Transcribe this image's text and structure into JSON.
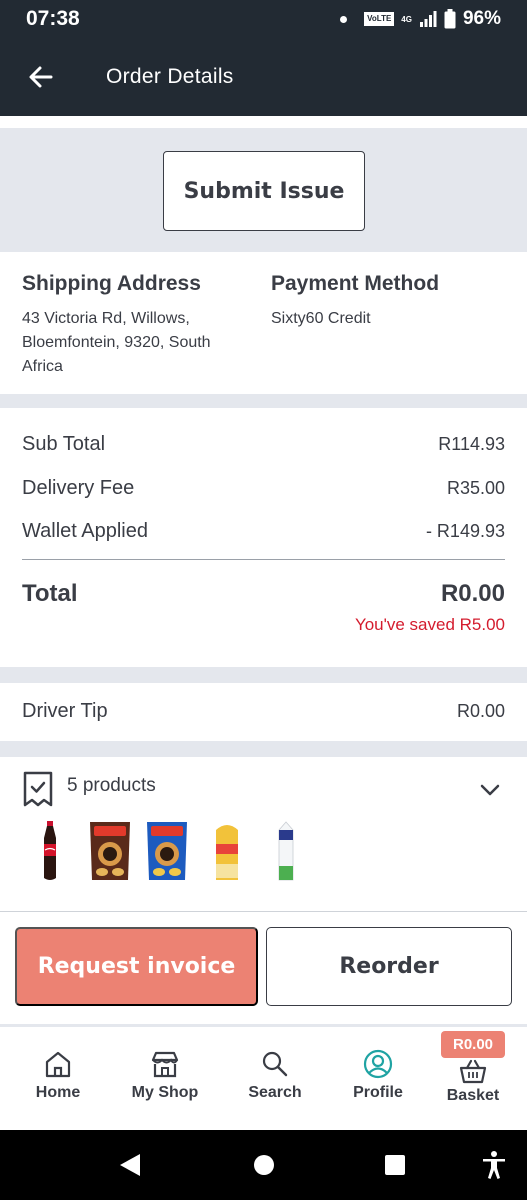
{
  "status_bar": {
    "time": "07:38",
    "volte": "VoLTE",
    "network": "4G",
    "battery": "96%"
  },
  "app_bar": {
    "title": "Order Details",
    "back_icon": "arrow-left-icon"
  },
  "submit_issue": {
    "label": "Submit Issue"
  },
  "shipping": {
    "title": "Shipping Address",
    "address_lines": [
      "43 Victoria Rd, Willows,",
      "Bloemfontein, 9320, South",
      "Africa"
    ]
  },
  "payment": {
    "title": "Payment Method",
    "method": "Sixty60 Credit"
  },
  "summary": {
    "sub_total_label": "Sub Total",
    "sub_total_value": "R114.93",
    "delivery_fee_label": "Delivery Fee",
    "delivery_fee_value": "R35.00",
    "wallet_label": "Wallet Applied",
    "wallet_value": "- R149.93",
    "total_label": "Total",
    "total_value": "R0.00",
    "saved_text": "You've saved R5.00"
  },
  "driver_tip": {
    "label": "Driver Tip",
    "value": "R0.00"
  },
  "products": {
    "count_label": "5 products",
    "items": [
      "coca-cola-bottle",
      "chips-packet-chocolate",
      "chips-packet-blue",
      "bread-loaf",
      "milk-carton"
    ]
  },
  "actions": {
    "request_invoice": "Request invoice",
    "reorder": "Reorder"
  },
  "bottom_nav": {
    "items": [
      {
        "label": "Home",
        "icon": "home-icon"
      },
      {
        "label": "My Shop",
        "icon": "shop-icon"
      },
      {
        "label": "Search",
        "icon": "search-icon"
      },
      {
        "label": "Profile",
        "icon": "profile-icon",
        "active": true
      },
      {
        "label": "Basket",
        "icon": "basket-icon"
      }
    ],
    "basket_badge": "R0.00"
  },
  "colors": {
    "dark": "#222a33",
    "accent": "#ec8273",
    "text": "#3a3d45",
    "saved_red": "#d41c2e",
    "profile_teal": "#1fa3a3",
    "band_gray": "#e4e7ed"
  }
}
